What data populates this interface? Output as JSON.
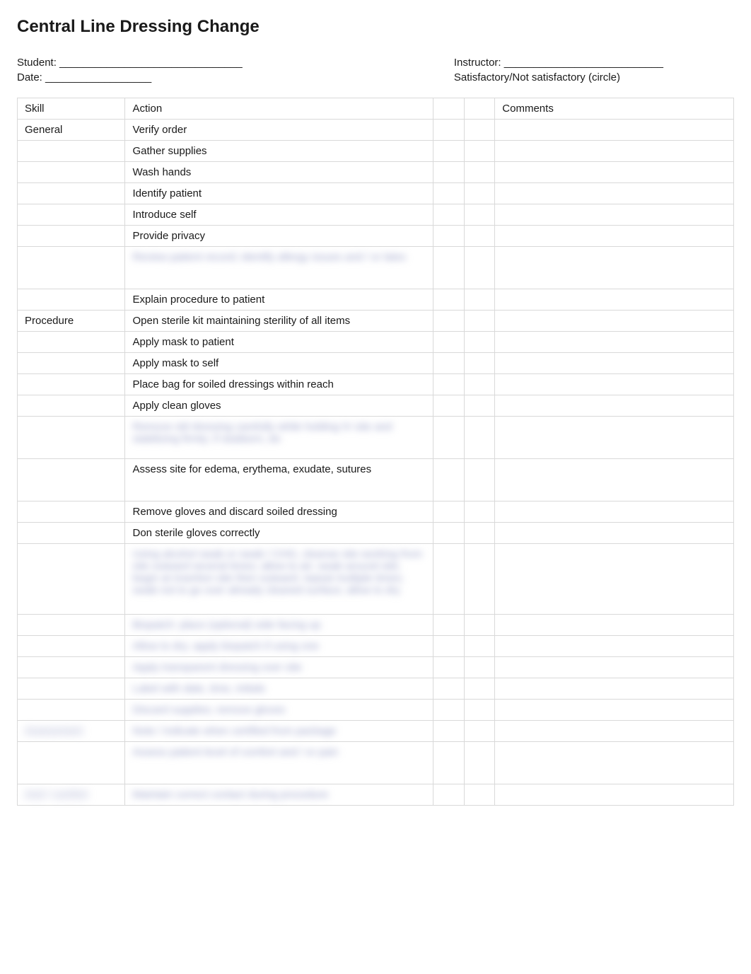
{
  "title": "Central Line Dressing Change",
  "header": {
    "student_label": "Student: _______________________________",
    "date_label": "Date: __________________",
    "instructor_label": "Instructor: ___________________________",
    "satisfactory_label": "Satisfactory/Not satisfactory (circle)"
  },
  "columns": {
    "skill": "Skill",
    "action": "Action",
    "sat": "",
    "comments": "Comments"
  },
  "rows": [
    {
      "skill": "General",
      "action": "Verify order",
      "blurred": false
    },
    {
      "skill": "",
      "action": "Gather supplies",
      "blurred": false
    },
    {
      "skill": "",
      "action": "Wash hands",
      "blurred": false
    },
    {
      "skill": "",
      "action": "Identify patient",
      "blurred": false
    },
    {
      "skill": "",
      "action": "Introduce self",
      "blurred": false
    },
    {
      "skill": "",
      "action": "Provide privacy",
      "blurred": false
    },
    {
      "skill": "",
      "action": "Review patient record; identify allergy issues and / or latex",
      "blurred": true,
      "tall": true
    },
    {
      "skill": "",
      "action": "Explain procedure to patient",
      "blurred": false
    },
    {
      "skill": "Procedure",
      "action": "Open sterile kit maintaining sterility of all items",
      "blurred": false
    },
    {
      "skill": "",
      "action": "Apply mask to patient",
      "blurred": false
    },
    {
      "skill": "",
      "action": "Apply mask to self",
      "blurred": false
    },
    {
      "skill": "",
      "action": "Place bag for soiled dressings within reach",
      "blurred": false
    },
    {
      "skill": "",
      "action": "Apply clean gloves",
      "blurred": false
    },
    {
      "skill": "",
      "action": "Remove old dressing carefully while holding IV site and stabilizing firmly; if stubborn, do",
      "blurred": true,
      "tall": true
    },
    {
      "skill": "",
      "action": "Assess site for edema, erythema, exudate, sutures",
      "blurred": false,
      "tall": true
    },
    {
      "skill": "",
      "action": "Remove gloves and discard soiled dressing",
      "blurred": false
    },
    {
      "skill": "",
      "action": "Don sterile gloves correctly",
      "blurred": false
    },
    {
      "skill": "",
      "action": "Using alcohol swab or swab / CHG, cleanse site working from site outward several times; allow to air; swab around site; begin at insertion site then outward; repeat multiple times; swab not to go over already cleaned surface; allow to dry",
      "blurred": true,
      "taller": true
    },
    {
      "skill": "",
      "action": "Biopatch: place (optional) side facing up",
      "blurred": true
    },
    {
      "skill": "",
      "action": "Allow to dry; apply biopatch if using one",
      "blurred": true
    },
    {
      "skill": "",
      "action": "Apply transparent dressing over site",
      "blurred": true
    },
    {
      "skill": "",
      "action": "Label with date, time, initials",
      "blurred": true
    },
    {
      "skill": "",
      "action": "Discard supplies; remove gloves",
      "blurred": true
    },
    {
      "skill": "Assessment",
      "action": "Note / indicate when certified from package",
      "blurred": true,
      "skill_blurred": true
    },
    {
      "skill": "",
      "action": "Assess patient level of comfort and / or pain",
      "blurred": true,
      "tall": true
    },
    {
      "skill": "And / comfort",
      "action": "Maintain correct contact during procedure",
      "blurred": true,
      "skill_blurred": true
    }
  ]
}
